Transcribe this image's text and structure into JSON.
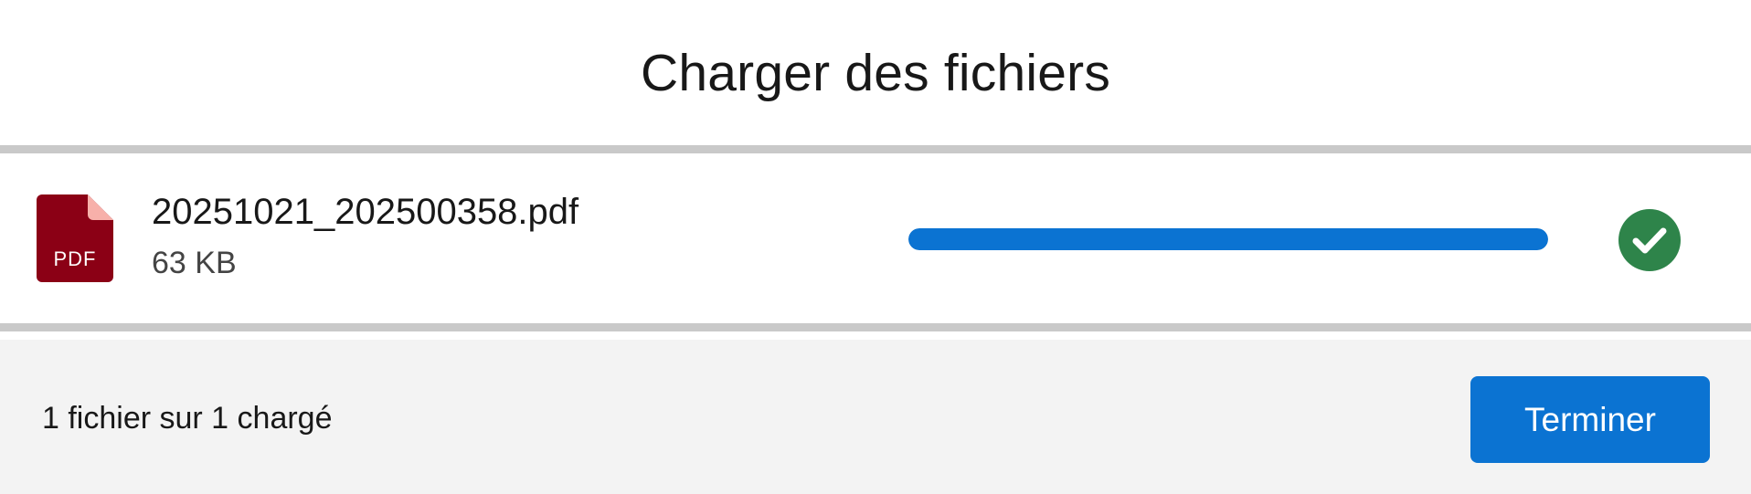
{
  "header": {
    "title": "Charger des fichiers"
  },
  "file": {
    "name": "20251021_202500358.pdf",
    "size": "63 KB",
    "type_label": "PDF",
    "icon": "pdf-file-icon",
    "progress_percent": 100,
    "status_icon": "check-circle-icon"
  },
  "footer": {
    "status_text": "1 fichier sur 1 chargé",
    "done_label": "Terminer"
  },
  "colors": {
    "pdf_icon": "#8b0015",
    "pdf_icon_fold": "#f7b0aa",
    "progress": "#0b73d2",
    "success": "#2e844a",
    "button": "#0b73d2"
  }
}
